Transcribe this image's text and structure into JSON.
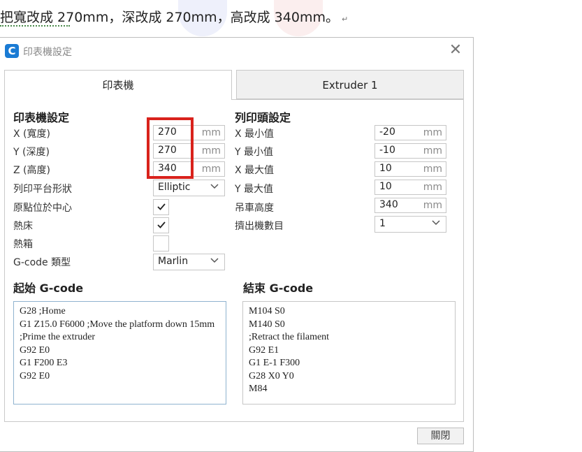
{
  "instruction": "把寬改成 270mm，深改成 270mm，高改成 340mm。",
  "paragraph_mark": "↵",
  "window": {
    "title": "印表機設定",
    "app_icon_letter": "C",
    "close_symbol": "✕"
  },
  "tabs": [
    {
      "label": "印表機",
      "active": true
    },
    {
      "label": "Extruder 1",
      "active": false
    }
  ],
  "printer_settings": {
    "title": "印表機設定",
    "width": {
      "label": "X (寬度)",
      "value": "270",
      "unit": "mm"
    },
    "depth": {
      "label": "Y (深度)",
      "value": "270",
      "unit": "mm"
    },
    "height": {
      "label": "Z (高度)",
      "value": "340",
      "unit": "mm"
    },
    "build_plate_shape": {
      "label": "列印平台形狀",
      "value": "Elliptic"
    },
    "origin_at_center": {
      "label": "原點位於中心",
      "checked": true
    },
    "heated_bed": {
      "label": "熱床",
      "checked": true
    },
    "heated_chamber": {
      "label": "熱箱",
      "checked": false
    },
    "gcode_flavor": {
      "label": "G-code 類型",
      "value": "Marlin"
    }
  },
  "head_settings": {
    "title": "列印頭設定",
    "x_min": {
      "label": "X 最小值",
      "value": "-20",
      "unit": "mm"
    },
    "y_min": {
      "label": "Y 最小值",
      "value": "-10",
      "unit": "mm"
    },
    "x_max": {
      "label": "X 最大值",
      "value": "10",
      "unit": "mm"
    },
    "y_max": {
      "label": "Y 最大值",
      "value": "10",
      "unit": "mm"
    },
    "gantry_height": {
      "label": "吊車高度",
      "value": "340",
      "unit": "mm"
    },
    "extruder_count": {
      "label": "擠出機數目",
      "value": "1"
    }
  },
  "start_gcode": {
    "title": "起始 G-code",
    "lines": [
      "G28 ;Home",
      "G1 Z15.0 F6000 ;Move the platform down 15mm",
      ";Prime the extruder",
      "G92 E0",
      "G1 F200 E3",
      "G92 E0"
    ]
  },
  "end_gcode": {
    "title": "結束 G-code",
    "lines": [
      "M104 S0",
      "M140 S0",
      ";Retract the filament",
      "G92 E1",
      "G1 E-1 F300",
      "G28 X0 Y0",
      "M84"
    ]
  },
  "close_button": "關閉",
  "colors": {
    "highlight": "#d9221c",
    "accent": "#1a7bd4"
  }
}
